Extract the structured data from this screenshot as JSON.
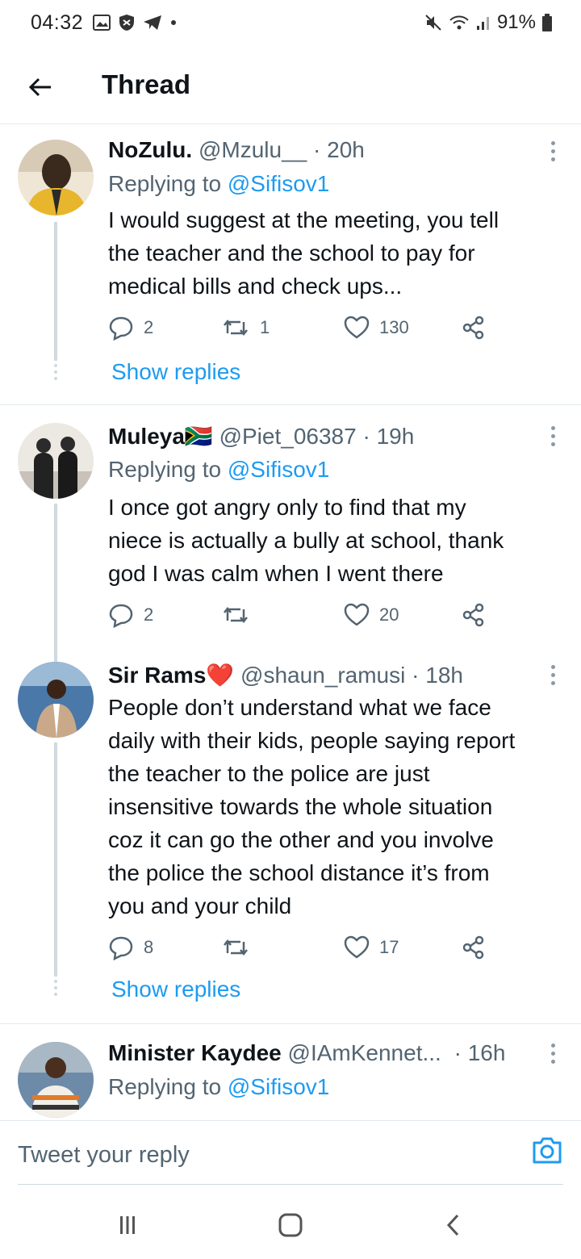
{
  "status_bar": {
    "time": "04:32",
    "battery": "91%",
    "icons_left": [
      "gallery-icon",
      "shield-icon",
      "telegram-icon",
      "dot-icon"
    ],
    "icons_right": [
      "mute-icon",
      "wifi-icon",
      "signal-icon",
      "battery-icon"
    ]
  },
  "header": {
    "title": "Thread"
  },
  "tweets": [
    {
      "name": "NoZulu.",
      "handle": "@Mzulu__",
      "time": "· 20h",
      "replying_prefix": "Replying to",
      "replying_to": "@Sifisov1",
      "text_lines": [
        "I would suggest at the meeting, you tell",
        "the teacher and the school to pay for",
        "medical bills and check ups..."
      ],
      "replies": "2",
      "retweets": "1",
      "likes": "130",
      "show_replies": "Show replies",
      "avatar_colors": [
        "#e8b62c",
        "#3a2a1e"
      ]
    },
    {
      "name": "Muleya🇿🇦",
      "handle": "@Piet_06387",
      "time": "· 19h",
      "replying_prefix": "Replying to",
      "replying_to": "@Sifisov1",
      "text_lines": [
        "I once got angry only to find that my",
        "niece is actually a bully at school, thank",
        "god I was calm when I went there"
      ],
      "replies": "2",
      "retweets": "",
      "likes": "20",
      "avatar_colors": [
        "#d9d4cc",
        "#2b2b2b"
      ]
    },
    {
      "name": "Sir Rams❤️",
      "handle": "@shaun_ramusi",
      "time": "· 18h",
      "text_lines": [
        "People don’t understand what we face",
        "daily with their kids, people saying report",
        "the teacher to the police are just",
        "insensitive towards the whole situation",
        "coz it can go the other and you involve",
        "the police the school distance it’s from",
        "you and your child"
      ],
      "replies": "8",
      "retweets": "",
      "likes": "17",
      "show_replies": "Show replies",
      "avatar_colors": [
        "#4a78a8",
        "#c9a98a"
      ]
    },
    {
      "name": "Minister Kaydee",
      "handle": "@IAmKennet...",
      "time": "· 16h",
      "replying_prefix": "Replying to",
      "replying_to": "@Sifisov1",
      "avatar_colors": [
        "#6d8aa8",
        "#e07a2a"
      ]
    }
  ],
  "reply_bar": {
    "placeholder": "Tweet your reply"
  },
  "nav_bar": {
    "buttons": [
      "recent-apps-icon",
      "home-icon",
      "back-icon"
    ]
  },
  "colors": {
    "accent": "#1d9bf0",
    "secondary_text": "#536471",
    "primary_text": "#0f1419"
  }
}
